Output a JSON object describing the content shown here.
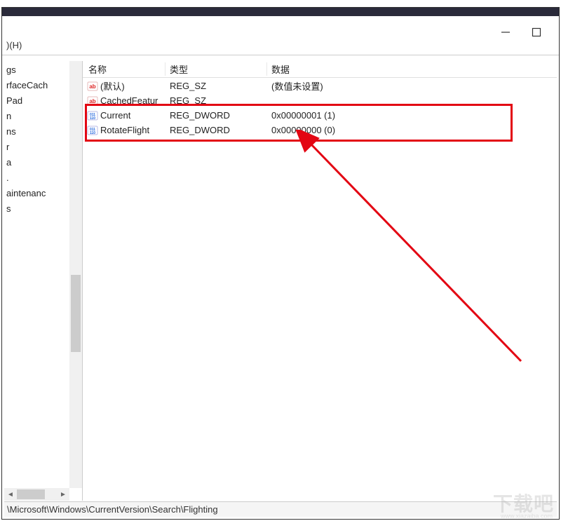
{
  "menu": {
    "help": "(H)"
  },
  "window_controls": {
    "minimize": "—",
    "maximize": "▢"
  },
  "tree": {
    "items": [
      "gs",
      "",
      "",
      "rfaceCach",
      "",
      "",
      "Pad",
      "n",
      "ns",
      "",
      "",
      "",
      "",
      "",
      "",
      "",
      "",
      "r",
      "a",
      "",
      ".",
      "aintenanc",
      "",
      "s"
    ]
  },
  "columns": {
    "name": "名称",
    "type": "类型",
    "data": "数据"
  },
  "rows": [
    {
      "icon": "ab",
      "name": "(默认)",
      "type": "REG_SZ",
      "data": "(数值未设置)"
    },
    {
      "icon": "ab",
      "name": "CachedFeatur",
      "type": "REG_SZ",
      "data": ""
    },
    {
      "icon": "bin",
      "name": "Current",
      "type": "REG_DWORD",
      "data": "0x00000001 (1)"
    },
    {
      "icon": "bin",
      "name": "RotateFlight",
      "type": "REG_DWORD",
      "data": "0x00000000 (0)"
    }
  ],
  "statusbar": {
    "path": "\\Microsoft\\Windows\\CurrentVersion\\Search\\Flighting"
  },
  "watermark": {
    "main": "下载吧",
    "sub": "www.xiazaiba.com"
  }
}
